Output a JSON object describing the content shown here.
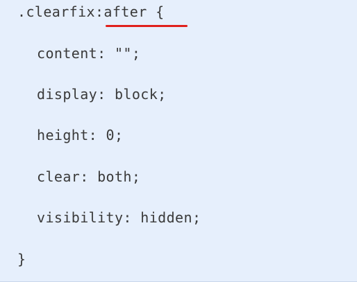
{
  "code": {
    "selector": ".clearfix",
    "pseudo": ":after",
    "open_brace": " {",
    "lines": [
      "content: \"\";",
      "display: block;",
      "height: 0;",
      "clear: both;",
      "visibility: hidden;"
    ],
    "close_brace": "}"
  },
  "colors": {
    "background": "#e6effc",
    "text": "#3a3a3a",
    "highlight_underline": "#e0201c"
  }
}
